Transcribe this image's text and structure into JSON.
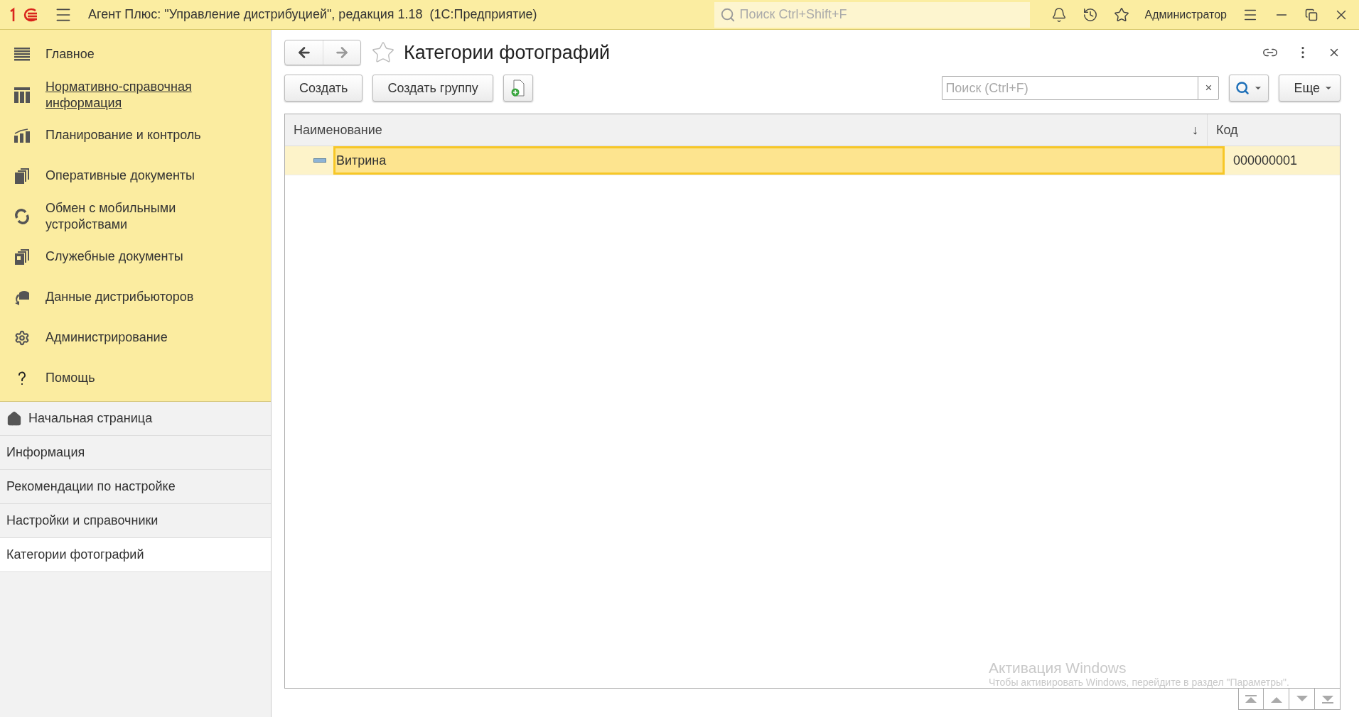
{
  "window": {
    "title": "Агент Плюс: \"Управление дистрибуцией\", редакция 1.18  (1С:Предприятие)",
    "search_placeholder": "Поиск Ctrl+Shift+F",
    "user": "Администратор"
  },
  "sidebar": {
    "sections": [
      {
        "label": "Главное",
        "hovered": false
      },
      {
        "label": "Нормативно-справочная информация",
        "hovered": true
      },
      {
        "label": "Планирование и контроль",
        "hovered": false
      },
      {
        "label": "Оперативные документы",
        "hovered": false
      },
      {
        "label": "Обмен с мобильными устройствами",
        "hovered": false
      },
      {
        "label": "Служебные документы",
        "hovered": false
      },
      {
        "label": "Данные дистрибьюторов",
        "hovered": false
      },
      {
        "label": "Администрирование",
        "hovered": false
      },
      {
        "label": "Помощь",
        "hovered": false
      }
    ],
    "open_items": [
      {
        "label": "Начальная страница",
        "selected": false
      },
      {
        "label": "Информация",
        "selected": false
      },
      {
        "label": "Рекомендации по настройке",
        "selected": false
      },
      {
        "label": "Настройки и справочники",
        "selected": false
      },
      {
        "label": "Категории фотографий",
        "selected": true
      }
    ]
  },
  "form": {
    "title": "Категории фотографий",
    "favorite": false,
    "buttons": [
      "Создать",
      "Создать группу"
    ],
    "search_placeholder": "Поиск (Ctrl+F)",
    "clear_symbol": "×",
    "more_label": "Еще",
    "table": {
      "columns": [
        {
          "label": "Наименование",
          "sort_symbol": "↓"
        },
        {
          "label": "Код"
        }
      ],
      "rows": [
        {
          "name": "Витрина",
          "code": "000000001",
          "selected": true
        }
      ]
    }
  },
  "overlay": {
    "title": "Активация Windows",
    "text": "Чтобы активировать Windows, перейдите в раздел \"Параметры\"."
  }
}
